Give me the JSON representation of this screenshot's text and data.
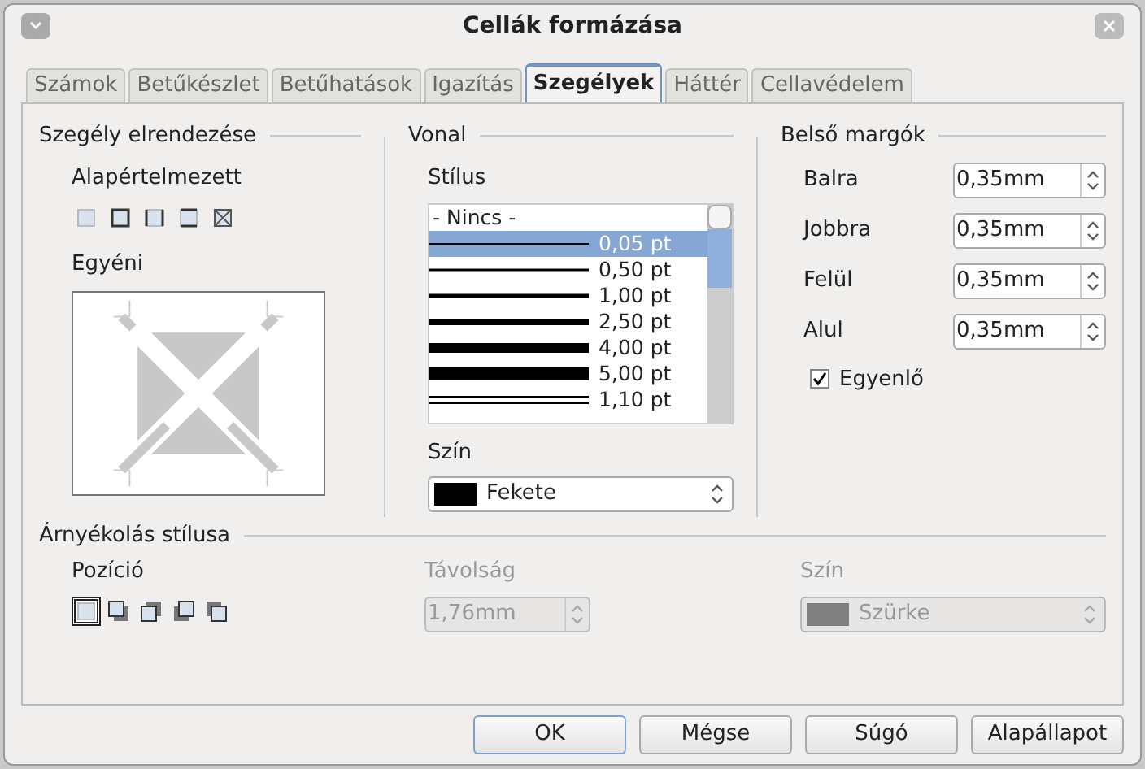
{
  "window": {
    "title": "Cellák formázása"
  },
  "tabs": [
    {
      "label": "Számok",
      "selected": false
    },
    {
      "label": "Betűkészlet",
      "selected": false
    },
    {
      "label": "Betűhatások",
      "selected": false
    },
    {
      "label": "Igazítás",
      "selected": false
    },
    {
      "label": "Szegélyek",
      "selected": true
    },
    {
      "label": "Háttér",
      "selected": false
    },
    {
      "label": "Cellavédelem",
      "selected": false
    }
  ],
  "border_layout": {
    "title": "Szegély elrendezése",
    "default_label": "Alapértelmezett",
    "presets": [
      {
        "kind": "none"
      },
      {
        "kind": "box"
      },
      {
        "kind": "sides"
      },
      {
        "kind": "topbottom"
      },
      {
        "kind": "diagonal"
      }
    ],
    "custom_label": "Egyéni"
  },
  "line": {
    "title": "Vonal",
    "style_label": "Stílus",
    "styles": [
      {
        "kind": "none",
        "label": "- Nincs -",
        "selected": false
      },
      {
        "kind": "hairline",
        "label": "0,05 pt",
        "selected": true
      },
      {
        "kind": "thin",
        "label": "0,50 pt",
        "selected": false
      },
      {
        "kind": "medium",
        "label": "1,00 pt",
        "selected": false
      },
      {
        "kind": "thick",
        "label": "2,50 pt",
        "selected": false
      },
      {
        "kind": "heavy",
        "label": "4,00 pt",
        "selected": false
      },
      {
        "kind": "heaviest",
        "label": "5,00 pt",
        "selected": false
      },
      {
        "kind": "double",
        "label": "1,10 pt",
        "selected": false
      }
    ],
    "color_label": "Szín",
    "color": {
      "name": "Fekete",
      "color": "#000000"
    }
  },
  "padding": {
    "title": "Belső margók",
    "fields": [
      {
        "label": "Balra",
        "value": "0,35mm"
      },
      {
        "label": "Jobbra",
        "value": "0,35mm"
      },
      {
        "label": "Felül",
        "value": "0,35mm"
      },
      {
        "label": "Alul",
        "value": "0,35mm"
      }
    ],
    "synchronize": {
      "label": "Egyenlő",
      "checked": true
    }
  },
  "shadow": {
    "title": "Árnyékolás stílusa",
    "position_label": "Pozíció",
    "positions": [
      {
        "kind": "none",
        "selected": true
      },
      {
        "kind": "bottomright",
        "selected": false
      },
      {
        "kind": "topright",
        "selected": false
      },
      {
        "kind": "bottomleft",
        "selected": false
      },
      {
        "kind": "topleft",
        "selected": false
      }
    ],
    "distance_label": "Távolság",
    "distance": {
      "value": "1,76mm",
      "disabled": true
    },
    "color_label": "Szín",
    "color": {
      "name": "Szürke",
      "color": "#808080",
      "disabled": true
    }
  },
  "buttons": [
    {
      "label": "OK",
      "default": true
    },
    {
      "label": "Mégse",
      "default": false
    },
    {
      "label": "Súgó",
      "default": false
    },
    {
      "label": "Alapállapot",
      "default": false
    }
  ]
}
